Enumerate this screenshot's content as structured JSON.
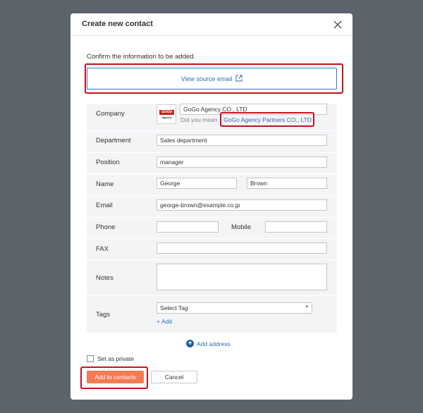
{
  "dialog": {
    "title": "Create new contact",
    "confirm_text": "Confirm the information to be added.",
    "source_email_label": "View source email"
  },
  "company": {
    "label": "Company",
    "value": "GoGo Agency CO., LTD",
    "logo_top": "GoGo",
    "logo_bottom": "Agency",
    "did_you_mean": "Did you mean",
    "suggestion": "GoGo Agency Partners CO., LTD"
  },
  "department": {
    "label": "Department",
    "value": "Sales department"
  },
  "position": {
    "label": "Position",
    "value": "manager"
  },
  "name": {
    "label": "Name",
    "first": "George",
    "last": "Brown"
  },
  "email": {
    "label": "Email",
    "value": "george-brown@example.co.jp"
  },
  "phone": {
    "label": "Phone",
    "value": "",
    "mobile_label": "Mobile",
    "mobile_value": ""
  },
  "fax": {
    "label": "FAX",
    "value": ""
  },
  "notes": {
    "label": "Notes",
    "value": ""
  },
  "tags": {
    "label": "Tags",
    "select_value": "Select Tag",
    "add_label": "Add"
  },
  "address": {
    "add_label": "Add address"
  },
  "private": {
    "label": "Set as private",
    "checked": false
  },
  "footer": {
    "add_label": "Add to contacts",
    "cancel_label": "Cancel"
  },
  "colors": {
    "primary_button": "#f47b52",
    "link": "#2f6db5",
    "highlight": "#c9111e",
    "backdrop": "#5c636b",
    "panel": "#f3f4f6"
  }
}
